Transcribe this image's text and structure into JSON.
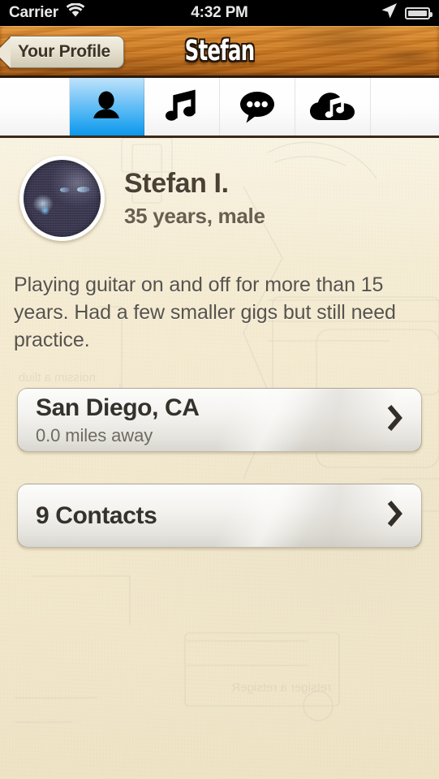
{
  "status_bar": {
    "carrier": "Carrier",
    "wifi_icon": "wifi-icon",
    "time": "4:32 PM",
    "location_icon": "location-arrow-icon",
    "battery_icon": "battery-icon"
  },
  "nav_bar": {
    "back_label": "Your Profile",
    "title": "Stefan"
  },
  "tab_bar": {
    "tabs": [
      {
        "name": "profile",
        "icon": "person-icon",
        "selected": true
      },
      {
        "name": "music",
        "icon": "music-note-icon",
        "selected": false
      },
      {
        "name": "messages",
        "icon": "chat-bubble-icon",
        "selected": false
      },
      {
        "name": "cloud-music",
        "icon": "cloud-music-icon",
        "selected": false
      }
    ],
    "active_color": "#0d96ec"
  },
  "profile": {
    "avatar_alt": "profile-photo",
    "name": "Stefan I.",
    "details": "35 years, male",
    "bio": "Playing guitar on and off for more than 15 years. Had a few smaller gigs but still need practice."
  },
  "rows": [
    {
      "name": "location-row",
      "title": "San Diego, CA",
      "subtitle": "0.0 miles away",
      "chevron_icon": "chevron-right-icon"
    },
    {
      "name": "contacts-row",
      "title": "9 Contacts",
      "subtitle": "",
      "chevron_icon": "chevron-right-icon"
    }
  ],
  "theme": {
    "wood_accent": "#ce7a20",
    "paper_bg": "#f3eacf",
    "text_dark": "#4a4034",
    "tab_blue": "#0d96ec"
  }
}
